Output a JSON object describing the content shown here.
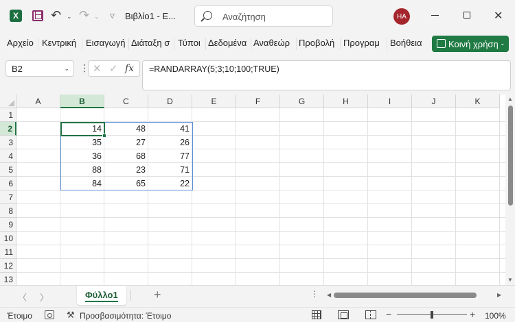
{
  "titlebar": {
    "app_logo": "X",
    "doc_title": "Βιβλίο1 - Ε...",
    "search_placeholder": "Αναζήτηση",
    "user_initials": "HA"
  },
  "ribbon": {
    "tabs": [
      "Αρχείο",
      "Κεντρική",
      "Εισαγωγή",
      "Διάταξη σ",
      "Τύποι",
      "Δεδομένα",
      "Αναθεώρ",
      "Προβολή",
      "Προγραμ",
      "Βοήθεια"
    ],
    "share_label": "Κοινή χρήση"
  },
  "formula_bar": {
    "name_box": "B2",
    "fx_label": "fx",
    "formula": "=RANDARRAY(5;3;10;100;TRUE)"
  },
  "grid": {
    "columns": [
      "A",
      "B",
      "C",
      "D",
      "E",
      "F",
      "G",
      "H",
      "I",
      "J",
      "K"
    ],
    "rows": [
      "1",
      "2",
      "3",
      "4",
      "5",
      "6",
      "7",
      "8",
      "9",
      "10",
      "11",
      "12",
      "13"
    ],
    "selected_column": "B",
    "selected_row": "2",
    "values": [
      [
        "14",
        "48",
        "41"
      ],
      [
        "35",
        "27",
        "26"
      ],
      [
        "36",
        "68",
        "77"
      ],
      [
        "88",
        "23",
        "71"
      ],
      [
        "84",
        "65",
        "22"
      ]
    ]
  },
  "sheets": {
    "active": "Φύλλο1",
    "add_label": "+"
  },
  "statusbar": {
    "ready": "Έτοιμο",
    "accessibility": "Προσβασιμότητα: Έτοιμο",
    "zoom_label": "100%",
    "zoom_fraction": 0.5
  }
}
